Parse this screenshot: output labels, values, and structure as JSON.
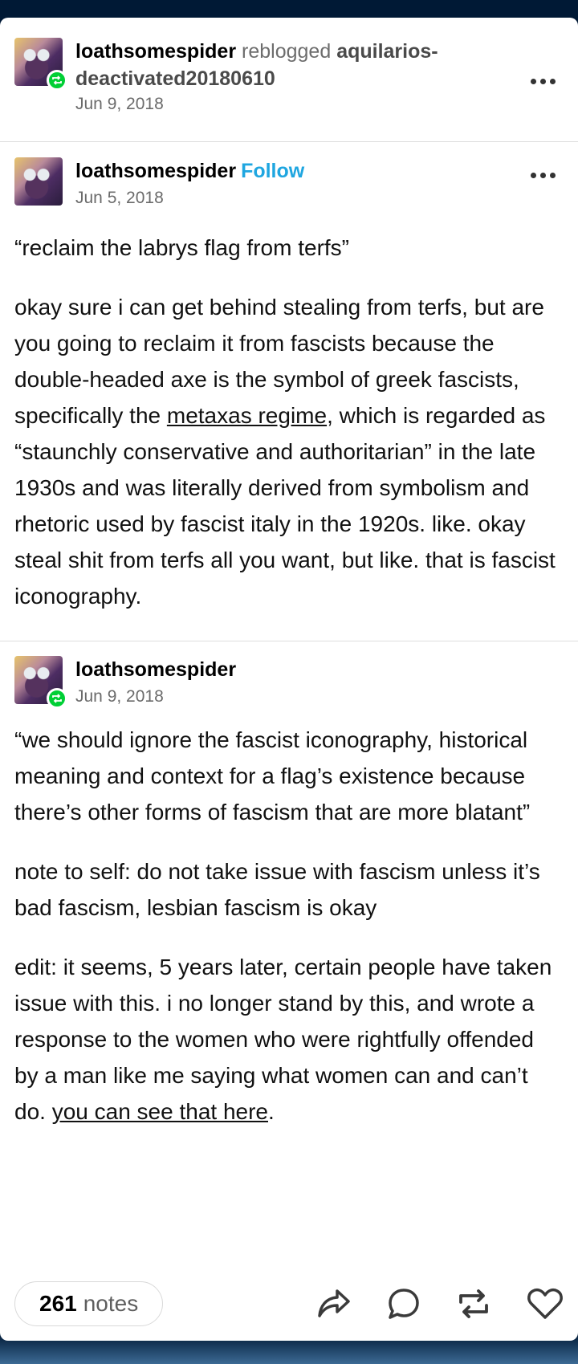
{
  "reblog_header": {
    "blog": "loathsomespider",
    "action": "reblogged",
    "source_line1": "aquilarios-",
    "source_line2": "deactivated20180610",
    "date": "Jun 9, 2018"
  },
  "original_post": {
    "blog": "loathsomespider",
    "follow_label": "Follow",
    "date": "Jun 5, 2018",
    "quote": "“reclaim the labrys flag from terfs”",
    "body_before_link": "okay sure i can get behind stealing from terfs, but are you going to reclaim it from fascists because the double-headed axe is the symbol of greek fascists, specifically the ",
    "link_text": "metaxas regime",
    "body_after_link": ", which is regarded as “staunchly conservative and authoritarian” in the late 1930s and was literally derived from symbolism and rhetoric used by fascist italy in the 1920s. like. okay steal shit from terfs all you want, but like. that is fascist iconography."
  },
  "reply_post": {
    "blog": "loathsomespider",
    "date": "Jun 9, 2018",
    "para1": "“we should ignore the fascist iconography, historical meaning and context for a flag’s existence because there’s other forms of fascism that are more blatant”",
    "para2": "note to self: do not take issue with fascism unless it’s bad fascism, lesbian fascism is okay",
    "para3_before_link": "edit: it seems, 5 years later, certain people have taken issue with this. i no longer stand by this, and wrote a response to the women who were rightfully offended by a man like me saying what women can and can’t do. ",
    "para3_link": "you can see that here",
    "para3_after_link": "."
  },
  "footer": {
    "notes_count": "261",
    "notes_label": "notes"
  },
  "icons": {
    "share": "share-icon",
    "reply": "comment-icon",
    "reblog": "reblog-icon",
    "like": "heart-icon",
    "more": "more-dots-icon",
    "reblog_badge": "reblog-badge-icon"
  },
  "colors": {
    "follow": "#1fa6e0",
    "reblog_badge": "#00cf35",
    "page_bg": "#001935"
  }
}
